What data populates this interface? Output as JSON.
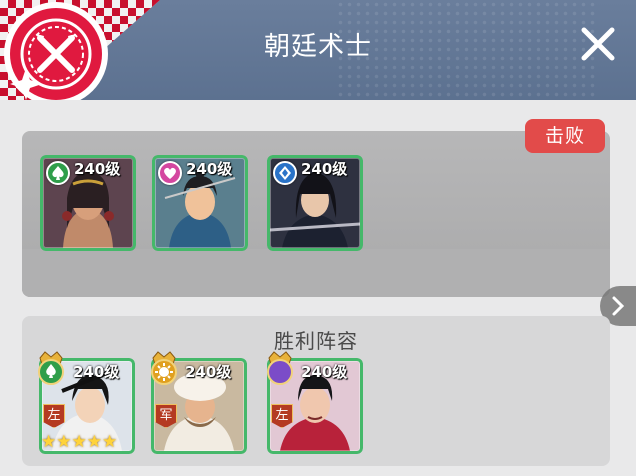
{
  "header": {
    "title": "朝廷术士"
  },
  "enemy": {
    "badge": "击败",
    "heroes": [
      {
        "level": "240级",
        "faction": "spade-icon",
        "color": "#2f9e4a"
      },
      {
        "level": "240级",
        "faction": "heart-icon",
        "color": "#d447a0"
      },
      {
        "level": "240级",
        "faction": "diamond-icon",
        "color": "#2a73c8"
      }
    ]
  },
  "victory": {
    "title": "胜利阵容",
    "heroes": [
      {
        "level": "240级",
        "faction": "spade-icon",
        "color": "#2f9e4a",
        "role": "左",
        "stars": 5
      },
      {
        "level": "240级",
        "faction": "sun-icon",
        "color": "#e0a020",
        "role": "军",
        "stars": 0
      },
      {
        "level": "240级",
        "faction": "moon-icon",
        "color": "#7b4cc8",
        "role": "左",
        "stars": 0
      }
    ]
  }
}
